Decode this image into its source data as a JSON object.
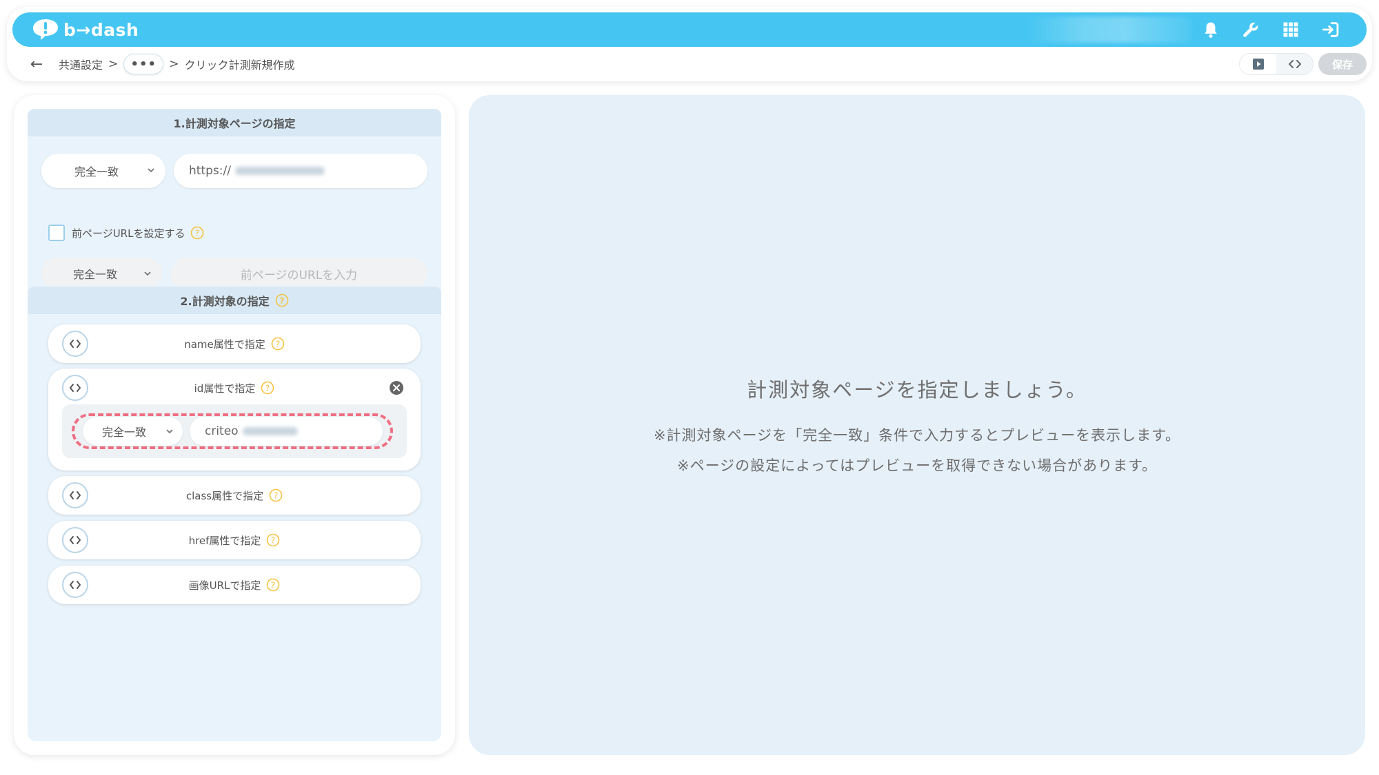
{
  "app": {
    "logo_text": "b→dash",
    "brand_color": "#45c6f2"
  },
  "header": {
    "icons": [
      "bell-icon",
      "wrench-icon",
      "grid-icon",
      "logout-icon"
    ]
  },
  "breadcrumb": {
    "items": [
      "共通設定",
      "クリック計測新規作成"
    ],
    "separator": ">",
    "more_label": "•••"
  },
  "toolbar": {
    "save_label": "保存"
  },
  "section1": {
    "title": "1.計測対象ページの指定",
    "match_select": "完全一致",
    "url_value": "https://",
    "prev_url_checkbox_label": "前ページURLを設定する",
    "prev_match_select": "完全一致",
    "prev_url_placeholder": "前ページのURLを入力"
  },
  "section2": {
    "title": "2.計測対象の指定",
    "targets": [
      {
        "label": "name属性で指定"
      },
      {
        "label": "id属性で指定",
        "match_select": "完全一致",
        "value": "criteo"
      },
      {
        "label": "class属性で指定"
      },
      {
        "label": "href属性で指定"
      },
      {
        "label": "画像URLで指定"
      }
    ]
  },
  "preview": {
    "title": "計測対象ページを指定しましょう。",
    "note1": "※計測対象ページを「完全一致」条件で入力するとプレビューを表示します。",
    "note2": "※ページの設定によってはプレビューを取得できない場合があります。"
  },
  "colors": {
    "highlight": "#ef6f83",
    "help": "#f5c342",
    "panel_bg": "#e9f3fb"
  }
}
